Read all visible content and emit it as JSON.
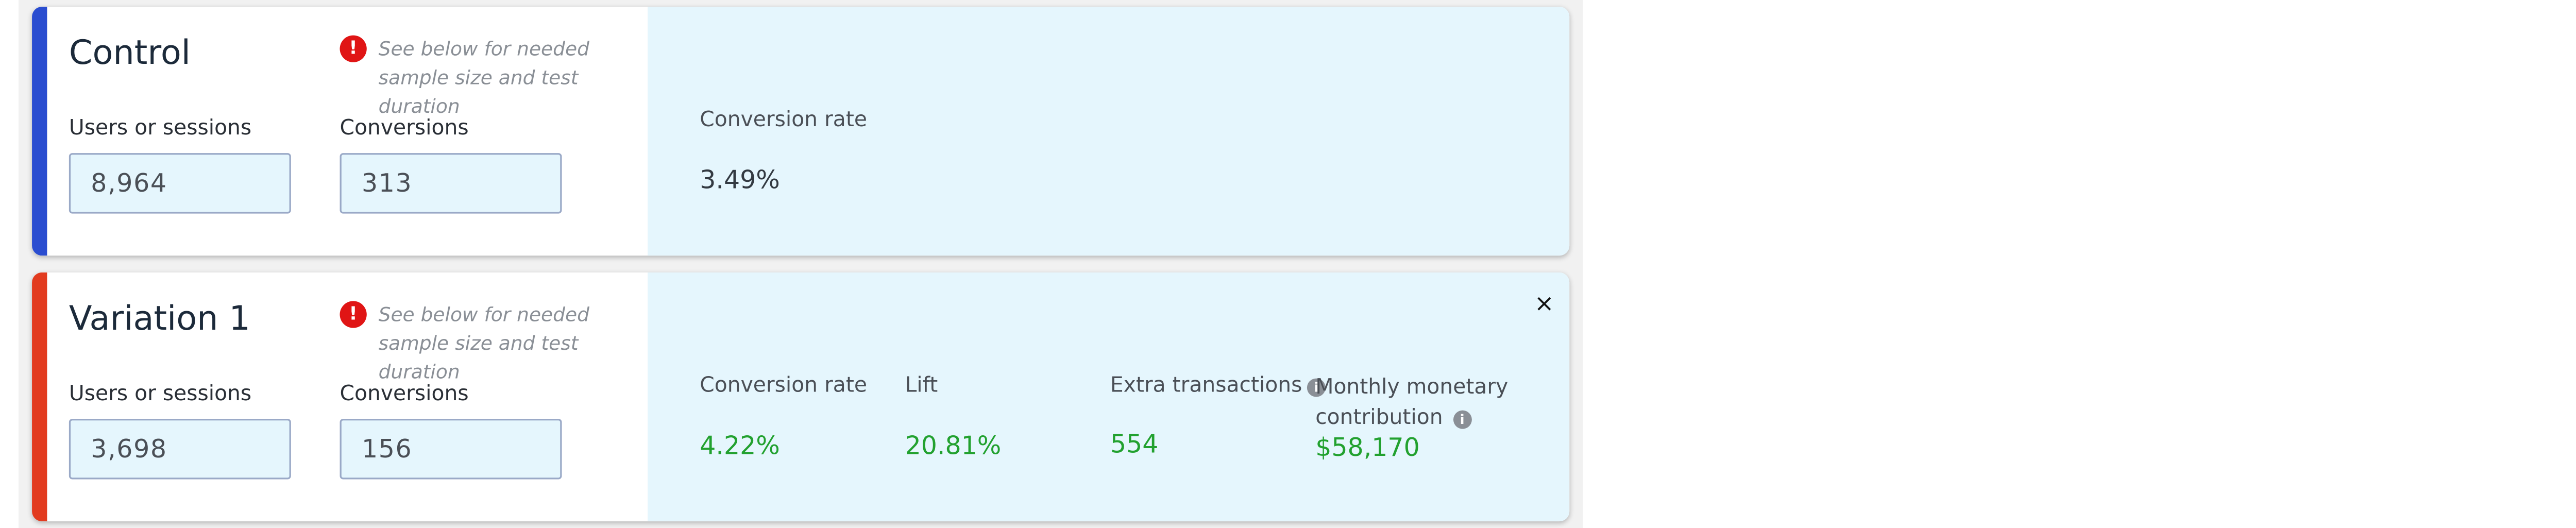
{
  "warning_text": "See below for needed sample size and test duration",
  "control": {
    "title": "Control",
    "users_label": "Users or sessions",
    "users_value": "8,964",
    "conversions_label": "Conversions",
    "conversions_value": "313",
    "metrics": {
      "conversion_rate_label": "Conversion rate",
      "conversion_rate_value": "3.49%"
    },
    "stripe_color": "#2a4dd0"
  },
  "variation": {
    "title": "Variation 1",
    "users_label": "Users or sessions",
    "users_value": "3,698",
    "conversions_label": "Conversions",
    "conversions_value": "156",
    "close_icon": "×",
    "metrics": {
      "conversion_rate_label": "Conversion rate",
      "conversion_rate_value": "4.22%",
      "lift_label": "Lift",
      "lift_value": "20.81%",
      "extra_transactions_label": "Extra transactions",
      "extra_transactions_value": "554",
      "monthly_label_line1": "Monthly monetary",
      "monthly_label_line2": "contribution",
      "monthly_value": "$58,170"
    },
    "stripe_color": "#e23b1f",
    "value_color": "#22a12f"
  },
  "icons": {
    "warning": "warning-icon",
    "info": "info-icon",
    "close": "close-icon"
  }
}
